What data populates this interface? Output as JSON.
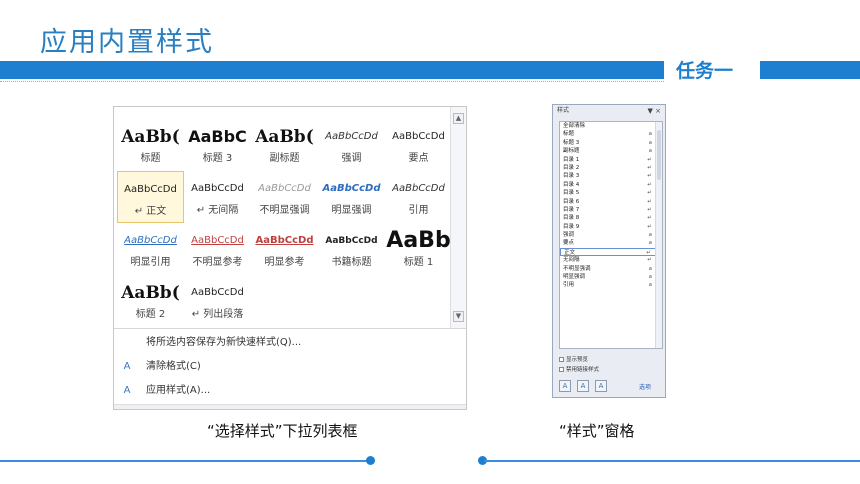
{
  "slide": {
    "title": "应用内置样式",
    "task_label": "任务一",
    "accent": "#1e7ed0"
  },
  "gallery": {
    "cells": [
      {
        "preview": "AaBb(",
        "label": "标题"
      },
      {
        "preview": "AaBbC",
        "label": "标题 3"
      },
      {
        "preview": "AaBb(",
        "label": "副标题"
      },
      {
        "preview": "AaBbCcDd",
        "label": "强调"
      },
      {
        "preview": "AaBbCcDd",
        "label": "要点"
      },
      {
        "preview": "AaBbCcDd",
        "label": "↵ 正文"
      },
      {
        "preview": "AaBbCcDd",
        "label": "↵ 无间隔"
      },
      {
        "preview": "AaBbCcDd",
        "label": "不明显强调"
      },
      {
        "preview": "AaBbCcDd",
        "label": "明显强调"
      },
      {
        "preview": "AaBbCcDd",
        "label": "引用"
      },
      {
        "preview": "AaBbCcDd",
        "label": "明显引用"
      },
      {
        "preview": "AaBbCcDd",
        "label": "不明显参考"
      },
      {
        "preview": "AaBbCcDd",
        "label": "明显参考"
      },
      {
        "preview": "AaBbCcDd",
        "label": "书籍标题"
      },
      {
        "preview": "AaBb",
        "label": "标题 1"
      },
      {
        "preview": "AaBb(",
        "label": "标题 2"
      },
      {
        "preview": "AaBbCcDd",
        "label": "↵ 列出段落"
      }
    ],
    "menu": [
      {
        "icon": "",
        "label": "将所选内容保存为新快速样式(Q)..."
      },
      {
        "icon": "A",
        "label": "清除格式(C)"
      },
      {
        "icon": "A",
        "label": "应用样式(A)..."
      }
    ],
    "caption": "“选择样式”下拉列表框"
  },
  "pane": {
    "title": "样式",
    "controls": "▼ ×",
    "items": [
      {
        "name": "全部清除",
        "mark": ""
      },
      {
        "name": "标题",
        "mark": "a"
      },
      {
        "name": "标题 3",
        "mark": "a"
      },
      {
        "name": "副标题",
        "mark": "a"
      },
      {
        "name": "目录 1",
        "mark": "↵"
      },
      {
        "name": "目录 2",
        "mark": "↵"
      },
      {
        "name": "目录 3",
        "mark": "↵"
      },
      {
        "name": "目录 4",
        "mark": "↵"
      },
      {
        "name": "目录 5",
        "mark": "↵"
      },
      {
        "name": "目录 6",
        "mark": "↵"
      },
      {
        "name": "目录 7",
        "mark": "↵"
      },
      {
        "name": "目录 8",
        "mark": "↵"
      },
      {
        "name": "目录 9",
        "mark": "↵"
      },
      {
        "name": "强调",
        "mark": "a"
      },
      {
        "name": "要点",
        "mark": "a"
      },
      {
        "name": "正文",
        "mark": "↵"
      },
      {
        "name": "无间隔",
        "mark": "↵"
      },
      {
        "name": "不明显强调",
        "mark": "a"
      },
      {
        "name": "明显强调",
        "mark": "a"
      },
      {
        "name": "引用",
        "mark": "a"
      }
    ],
    "show_preview": "显示预览",
    "disable_linked": "禁用链接样式",
    "options": "选项",
    "caption": "“样式”窗格"
  }
}
